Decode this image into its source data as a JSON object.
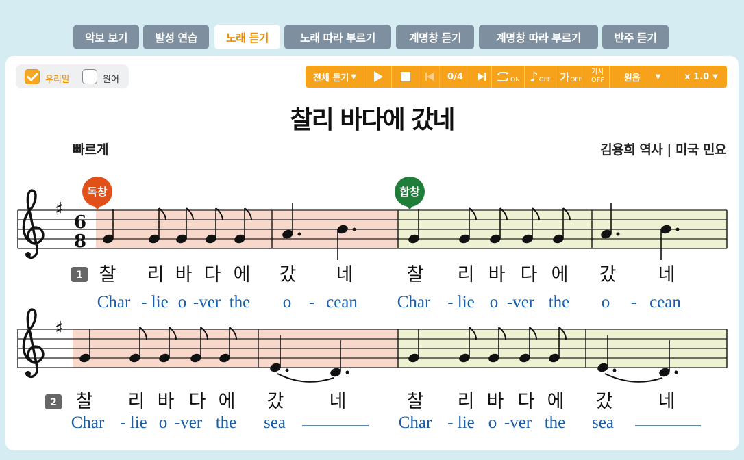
{
  "tabs": [
    {
      "label": "악보 보기",
      "active": false
    },
    {
      "label": "발성 연습",
      "active": false
    },
    {
      "label": "노래 듣기",
      "active": true
    },
    {
      "label": "노래 따라 부르기",
      "active": false
    },
    {
      "label": "계명창 듣기",
      "active": false
    },
    {
      "label": "계명창 따라 부르기",
      "active": false
    },
    {
      "label": "반주 듣기",
      "active": false
    }
  ],
  "lang_toggle": {
    "korean_label": "우리말",
    "korean_checked": true,
    "original_label": "원어",
    "original_checked": false
  },
  "player": {
    "mode_label": "전체 듣기",
    "track_counter": "0/4",
    "repeat_state": "ON",
    "note_state": "OFF",
    "lyric_glyph": "가",
    "lyric_state": "OFF",
    "lyric_line1": "가사",
    "lyric_line2": "OFF",
    "pitch_label": "원음",
    "speed_label": "x 1.0"
  },
  "song": {
    "title": "찰리 바다에 갔네",
    "tempo": "빠르게",
    "credits": "김용희 역사 | 미국 민요"
  },
  "badges": {
    "solo": "독창",
    "chorus": "합창"
  },
  "colors": {
    "solo": "#f9d8cc",
    "chorus": "#eef2d3",
    "badge_solo": "#e2501a",
    "badge_chorus": "#1f7f3a",
    "accent": "#f7a21b",
    "tab": "#7e8fa0"
  },
  "verses": [
    {
      "number": "1",
      "korean": [
        "찰",
        "리",
        "바",
        "다",
        "에",
        "갔",
        "네",
        "찰",
        "리",
        "바",
        "다",
        "에",
        "갔",
        "네"
      ],
      "english": [
        "Char",
        "- lie",
        "o",
        "-ver",
        "the",
        "o",
        "-",
        "cean",
        "Char",
        "- lie",
        "o",
        "-ver",
        "the",
        "o",
        "-",
        "cean"
      ]
    },
    {
      "number": "2",
      "korean": [
        "찰",
        "리",
        "바",
        "다",
        "에",
        "갔",
        "네",
        "찰",
        "리",
        "바",
        "다",
        "에",
        "갔",
        "네"
      ],
      "english": [
        "Char",
        "- lie",
        "o",
        "-ver",
        "the",
        "sea",
        "Char",
        "- lie",
        "o",
        "-ver",
        "the",
        "sea"
      ]
    }
  ]
}
